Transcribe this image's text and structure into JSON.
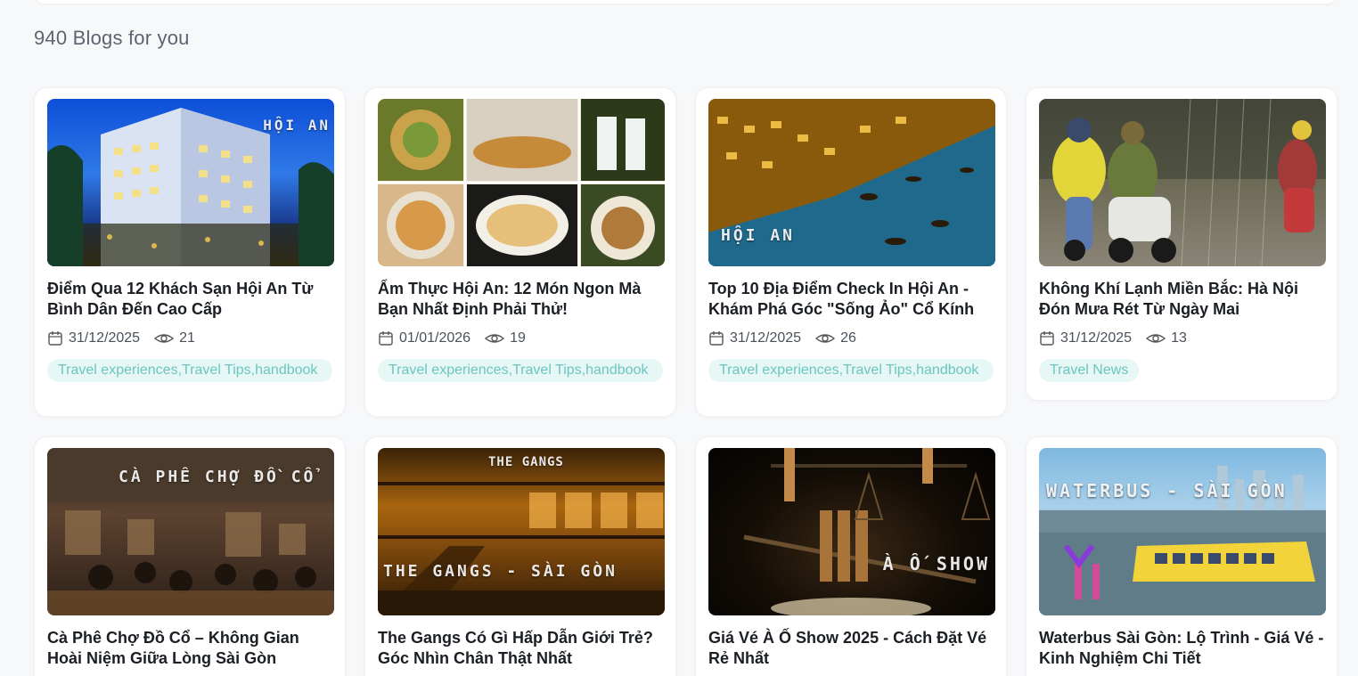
{
  "heading": "940 Blogs for you",
  "cards": [
    {
      "title": "Điểm Qua 12 Khách Sạn Hội An Từ Bình Dân Đến Cao Cấp",
      "date": "31/12/2025",
      "views": "21",
      "tag": "Travel experiences,Travel Tips,handbook",
      "image_text": "HỘI AN"
    },
    {
      "title": "Ẩm Thực Hội An: 12 Món Ngon Mà Bạn Nhất Định Phải Thử!",
      "date": "01/01/2026",
      "views": "19",
      "tag": "Travel experiences,Travel Tips,handbook",
      "image_text": ""
    },
    {
      "title": "Top 10 Địa Điểm Check In Hội An - Khám Phá Góc \"Sống Ảo\" Cổ Kính",
      "date": "31/12/2025",
      "views": "26",
      "tag": "Travel experiences,Travel Tips,handbook",
      "image_text": "HỘI AN"
    },
    {
      "title": "Không Khí Lạnh Miền Bắc: Hà Nội Đón Mưa Rét Từ Ngày Mai",
      "date": "31/12/2025",
      "views": "13",
      "tag": "Travel News",
      "image_text": ""
    },
    {
      "title": "Cà Phê Chợ Đồ Cổ – Không Gian Hoài Niệm Giữa Lòng Sài Gòn",
      "image_text": "CÀ PHÊ CHỢ ĐỒ CỔ"
    },
    {
      "title": "The Gangs Có Gì Hấp Dẫn Giới Trẻ? Góc Nhìn Chân Thật Nhất",
      "image_text": "THE GANGS - SÀI GÒN"
    },
    {
      "title": "Giá Vé À Ố Show 2025 - Cách Đặt Vé Rẻ Nhất",
      "image_text": "À Ố SHOW"
    },
    {
      "title": "Waterbus Sài Gòn: Lộ Trình - Giá Vé - Kinh Nghiệm Chi Tiết",
      "image_text": "WATERBUS - SÀI GÒN"
    }
  ],
  "colors": {
    "tag_bg": "#e6f7f5",
    "tag_text": "#6cc6c0",
    "title": "#1b1f24"
  },
  "icons": {
    "date": "calendar-icon",
    "views": "eye-icon"
  }
}
